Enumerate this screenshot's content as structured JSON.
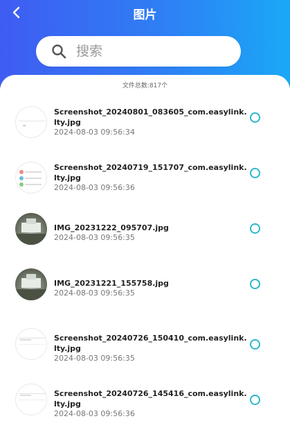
{
  "header": {
    "title": "图片",
    "back_icon": "chevron-left-icon",
    "gradient": [
      "#3f5cf2",
      "#1aa8f6"
    ]
  },
  "search": {
    "placeholder": "搜索",
    "icon": "search-icon"
  },
  "file_count": "文件总数:817个",
  "accent_color": "#2db7cc",
  "files": [
    {
      "name": "Screenshot_20240801_083605_com.easylink.lty.jpg",
      "time": "2024-08-03 09:56:34",
      "thumb": "screenshot"
    },
    {
      "name": "Screenshot_20240719_151707_com.easylink.lty.jpg",
      "time": "2024-08-03 09:56:36",
      "thumb": "screenshot"
    },
    {
      "name": "IMG_20231222_095707.jpg",
      "time": "2024-08-03 09:56:35",
      "thumb": "photo"
    },
    {
      "name": "IMG_20231221_155758.jpg",
      "time": "2024-08-03 09:56:35",
      "thumb": "photo"
    },
    {
      "name": "Screenshot_20240726_150410_com.easylink.lty.jpg",
      "time": "2024-08-03 09:56:35",
      "thumb": "screenshot"
    },
    {
      "name": "Screenshot_20240726_145416_com.easylink.lty.jpg",
      "time": "2024-08-03 09:56:36",
      "thumb": "screenshot"
    }
  ]
}
